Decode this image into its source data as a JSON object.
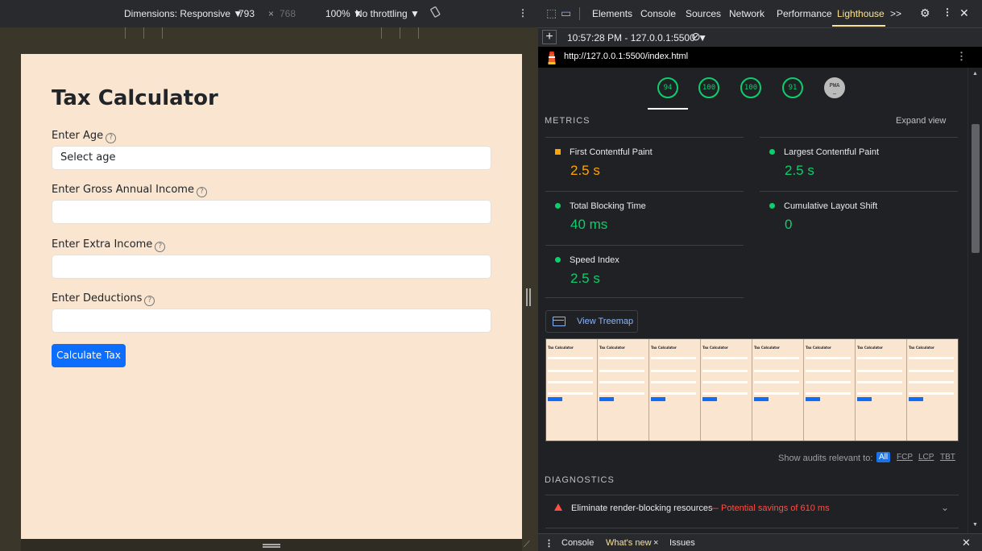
{
  "device_toolbar": {
    "dimensions_label": "Dimensions: Responsive ▼",
    "width": "793",
    "times": "×",
    "height": "768",
    "zoom": "100% ▼",
    "throttling": "No throttling ▼",
    "rotate_icon": "rotate-icon",
    "more_icon": "kebab-icon"
  },
  "app": {
    "title": "Tax Calculator",
    "fields": [
      {
        "label": "Enter Age",
        "placeholder": "Select age"
      },
      {
        "label": "Enter Gross Annual Income",
        "placeholder": ""
      },
      {
        "label": "Enter Extra Income",
        "placeholder": ""
      },
      {
        "label": "Enter Deductions",
        "placeholder": ""
      }
    ],
    "help_glyph": "?",
    "button": "Calculate Tax",
    "colors": {
      "background": "#fae6d0",
      "button": "#0d6efd"
    }
  },
  "devtools": {
    "tabs": [
      "Elements",
      "Console",
      "Sources",
      "Network",
      "Performance",
      "Lighthouse"
    ],
    "more_tabs": ">>",
    "active_tab": "Lighthouse",
    "report": "10:57:28 PM - 127.0.0.1:5500 ▼",
    "url": "http://127.0.0.1:5500/index.html",
    "scores": [
      "94",
      "100",
      "100",
      "91"
    ],
    "pwa_label": "PWA",
    "metrics": {
      "heading": "METRICS",
      "expand": "Expand view",
      "items": [
        {
          "name": "First Contentful Paint",
          "value": "2.5 s",
          "status": "average"
        },
        {
          "name": "Largest Contentful Paint",
          "value": "2.5 s",
          "status": "pass"
        },
        {
          "name": "Total Blocking Time",
          "value": "40 ms",
          "status": "pass"
        },
        {
          "name": "Cumulative Layout Shift",
          "value": "0",
          "status": "pass"
        },
        {
          "name": "Speed Index",
          "value": "2.5 s",
          "status": "pass"
        }
      ]
    },
    "treemap_button": "View Treemap",
    "filmstrip": {
      "frame_title": "Tax Calculator"
    },
    "show_audits": {
      "label": "Show audits relevant to:",
      "filters": [
        "All",
        "FCP",
        "LCP",
        "TBT"
      ]
    },
    "diagnostics": {
      "heading": "DIAGNOSTICS",
      "items": [
        {
          "title": "Eliminate render-blocking resources",
          "savings": "— Potential savings of 610 ms"
        }
      ]
    },
    "drawer": {
      "tabs": [
        "Console",
        "What's new",
        "Issues"
      ],
      "close_glyph": "×"
    },
    "colors": {
      "pass": "#0cce6b",
      "average": "#ffa400",
      "fail": "#ff4e42",
      "active_tab": "#fde293"
    }
  }
}
